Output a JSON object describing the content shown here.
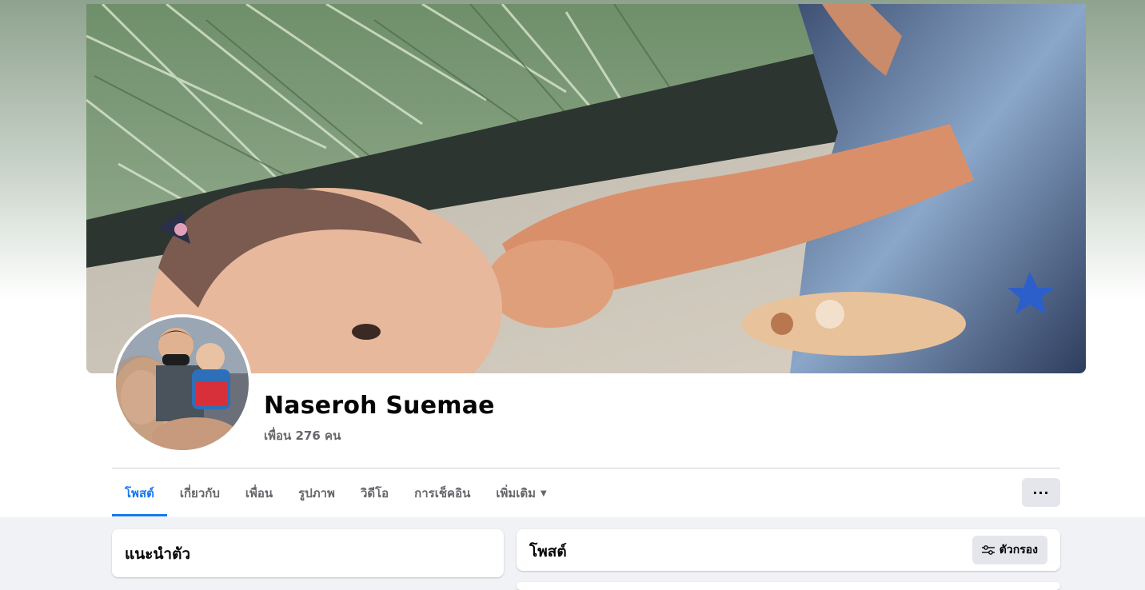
{
  "profile": {
    "name": "Naseroh Suemae",
    "friends_text": "เพื่อน 276 คน"
  },
  "tabs": [
    {
      "label": "โพสต์",
      "active": true
    },
    {
      "label": "เกี่ยวกับ"
    },
    {
      "label": "เพื่อน"
    },
    {
      "label": "รูปภาพ"
    },
    {
      "label": "วิดีโอ"
    },
    {
      "label": "การเช็คอิน"
    },
    {
      "label": "เพิ่มเติม",
      "dropdown": true
    }
  ],
  "more_button_label": "···",
  "intro": {
    "title": "แนะนำตัว"
  },
  "posts": {
    "title": "โพสต์",
    "filter_label": "ตัวกรอง"
  },
  "colors": {
    "accent": "#1877f2",
    "text_secondary": "#65676b",
    "button_bg": "#e4e6eb"
  }
}
